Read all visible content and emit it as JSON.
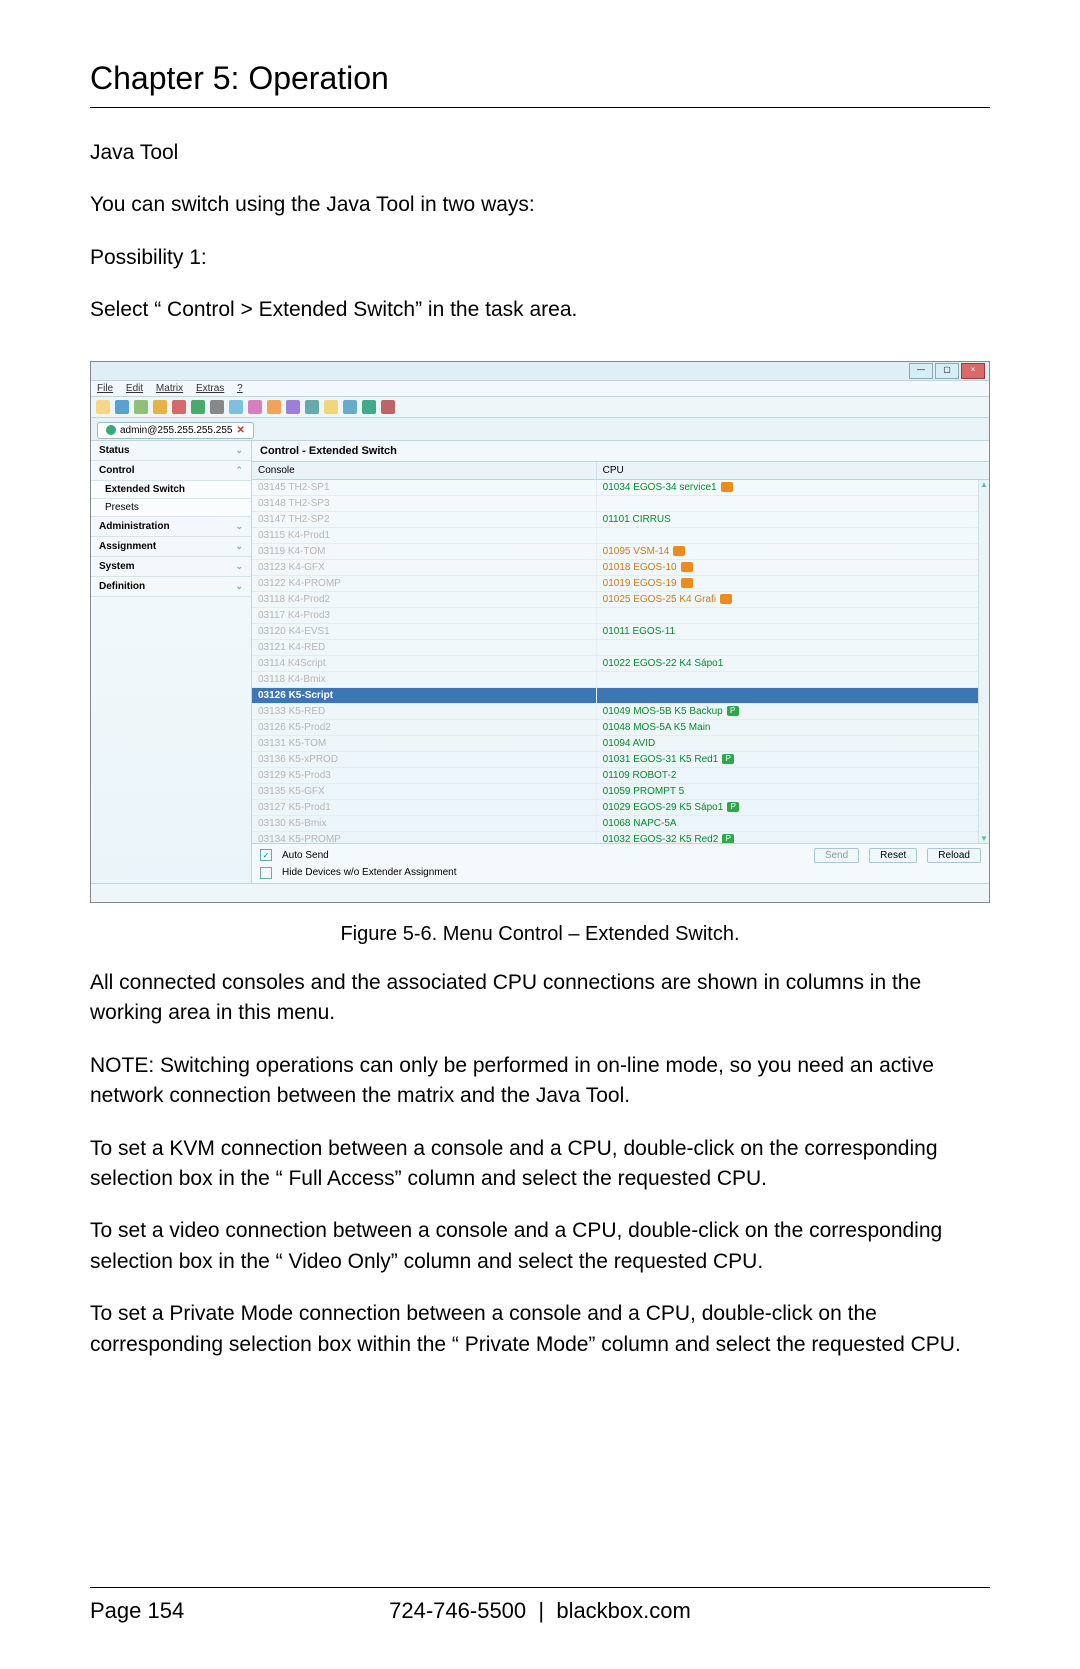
{
  "chapter_title": "Chapter 5: Operation",
  "intro": {
    "heading": "Java Tool",
    "line1": "You can switch using the Java Tool in two ways:",
    "poss": "Possibility 1:",
    "select": "Select “ Control > Extended Switch” in the task area."
  },
  "screenshot": {
    "menu": [
      "File",
      "Edit",
      "Matrix",
      "Extras",
      "?"
    ],
    "window_buttons": [
      "min",
      "max",
      "x"
    ],
    "tab_label": "admin@255.255.255.255",
    "sidebar": {
      "groups": [
        {
          "label": "Status",
          "chev": "⌄"
        },
        {
          "label": "Control",
          "chev": "⌃",
          "items": [
            {
              "label": "Extended Switch",
              "sel": true
            },
            {
              "label": "Presets"
            }
          ]
        },
        {
          "label": "Administration",
          "chev": "⌄"
        },
        {
          "label": "Assignment",
          "chev": "⌄"
        },
        {
          "label": "System",
          "chev": "⌄"
        },
        {
          "label": "Definition",
          "chev": "⌄"
        }
      ]
    },
    "panel_title": "Control - Extended Switch",
    "columns": {
      "console": "Console",
      "cpu": "CPU"
    },
    "rows": [
      {
        "console": "03145  TH2-SP1",
        "cpu": "01034  EGOS-34 service1",
        "col": "green",
        "badge": "o"
      },
      {
        "console": "03148  TH2-SP3",
        "cpu": ""
      },
      {
        "console": "03147  TH2-SP2",
        "cpu": "01101  CIRRUS",
        "col": "green"
      },
      {
        "console": "03115  K4-Prod1",
        "cpu": ""
      },
      {
        "console": "03119  K4-TOM",
        "cpu": "01095  VSM-14",
        "col": "orange",
        "badge": "o"
      },
      {
        "console": "03123  K4-GFX",
        "cpu": "01018  EGOS-10",
        "col": "orange",
        "badge": "o"
      },
      {
        "console": "03122  K4-PROMP",
        "cpu": "01019  EGOS-19",
        "col": "orange",
        "badge": "o"
      },
      {
        "console": "03118  K4-Prod2",
        "cpu": "01025  EGOS-25 K4 Grafi",
        "col": "orange",
        "badge": "o"
      },
      {
        "console": "03117  K4-Prod3",
        "cpu": ""
      },
      {
        "console": "03120  K4-EVS1",
        "cpu": "01011  EGOS-11",
        "col": "green"
      },
      {
        "console": "03121  K4-RED",
        "cpu": ""
      },
      {
        "console": "03114  K4Script",
        "cpu": "01022  EGOS-22 K4 Sápo1",
        "col": "green"
      },
      {
        "console": "03118  K4-Bmix",
        "cpu": ""
      },
      {
        "console": "03126  K5-Script",
        "cpu": "",
        "sel": true
      },
      {
        "console": "03133  K5-RED",
        "cpu": "01049  MOS-5B K5 Backup",
        "col": "green",
        "badge": "g"
      },
      {
        "console": "03126  K5-Prod2",
        "cpu": "01048  MOS-5A K5 Main",
        "col": "green"
      },
      {
        "console": "03131  K5-TOM",
        "cpu": "01094  AVID",
        "col": "green"
      },
      {
        "console": "03136  K5-xPROD",
        "cpu": "01031  EGOS-31 K5 Red1",
        "col": "green",
        "badge": "g"
      },
      {
        "console": "03129  K5-Prod3",
        "cpu": "01109  ROBOT-2",
        "col": "green"
      },
      {
        "console": "03135  K5-GFX",
        "cpu": "01059  PROMPT 5",
        "col": "green"
      },
      {
        "console": "03127  K5-Prod1",
        "cpu": "01029  EGOS-29 K5 Sápo1",
        "col": "green",
        "badge": "g"
      },
      {
        "console": "03130  K5-Bmix",
        "cpu": "01068  NAPC-5A",
        "col": "green"
      },
      {
        "console": "03134  K5-PROMP",
        "cpu": "01032  EGOS-32 K5 Red2",
        "col": "green",
        "badge": "g"
      }
    ],
    "footer": {
      "auto_send": "Auto Send",
      "hide": "Hide Devices w/o Extender Assignment",
      "buttons": [
        "Send",
        "Reset",
        "Reload"
      ]
    }
  },
  "caption": "Figure 5-6. Menu Control – Extended Switch.",
  "para1": "All connected consoles and the associated CPU connections are shown in columns in the working area in this menu.",
  "note1": "NOTE: Switching operations can only be performed in on-line mode, so you need an active network connection between the matrix and the Java Tool.",
  "para2": "To set a KVM connection between a console and a CPU, double-click on the corresponding selection box in the “ Full Access” column and select the requested CPU.",
  "para3": "To set a video connection between a console and a CPU, double-click on the corresponding selection box in the “ Video Only” column and select the requested CPU.",
  "para4": "To set a Private Mode connection between a console and a CPU, double-click on the corresponding selection box within the “ Private Mode” column and select the requested CPU.",
  "footer": {
    "page": "Page 154",
    "phone": "724-746-5500",
    "site": "blackbox.com"
  }
}
